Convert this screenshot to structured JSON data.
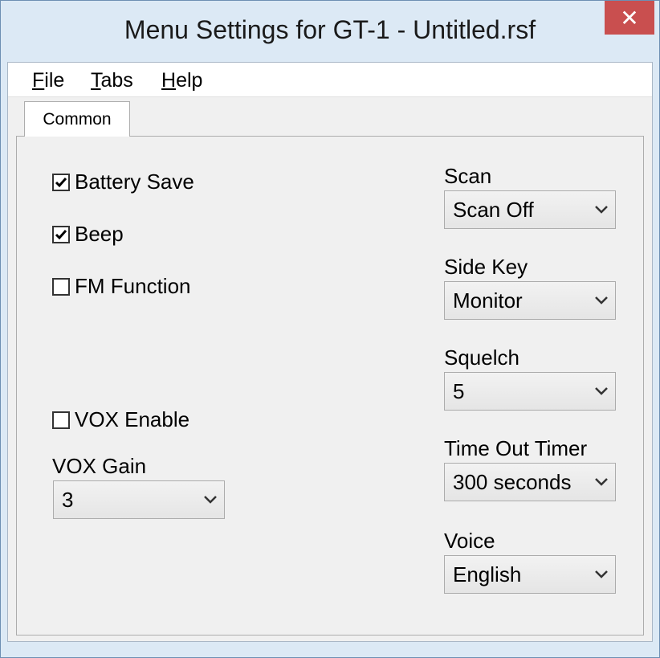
{
  "window": {
    "title": "Menu Settings for GT-1 - Untitled.rsf",
    "close_glyph": "✕"
  },
  "menubar": {
    "items": [
      {
        "mnemonic": "F",
        "rest": "ile"
      },
      {
        "mnemonic": "T",
        "rest": "abs"
      },
      {
        "mnemonic": "H",
        "rest": "elp"
      }
    ]
  },
  "tabs": [
    {
      "label": "Common",
      "selected": true
    }
  ],
  "left": {
    "battery_save": {
      "label": "Battery Save",
      "checked": true
    },
    "beep": {
      "label": "Beep",
      "checked": true
    },
    "fm_function": {
      "label": "FM Function",
      "checked": false
    },
    "vox_enable": {
      "label": "VOX Enable",
      "checked": false
    },
    "vox_gain": {
      "label": "VOX Gain",
      "value": "3"
    }
  },
  "right": {
    "scan": {
      "label": "Scan",
      "value": "Scan Off"
    },
    "side_key": {
      "label": "Side Key",
      "value": "Monitor"
    },
    "squelch": {
      "label": "Squelch",
      "value": "5"
    },
    "time_out_timer": {
      "label": "Time Out Timer",
      "value": "300 seconds"
    },
    "voice": {
      "label": "Voice",
      "value": "English"
    }
  },
  "icons": {
    "check": "check-mark-icon",
    "dropdown": "chevron-down-icon",
    "close": "close-icon"
  },
  "colors": {
    "frame": "#dce9f5",
    "close_button": "#c94f4f",
    "panel": "#f0f0f0"
  }
}
